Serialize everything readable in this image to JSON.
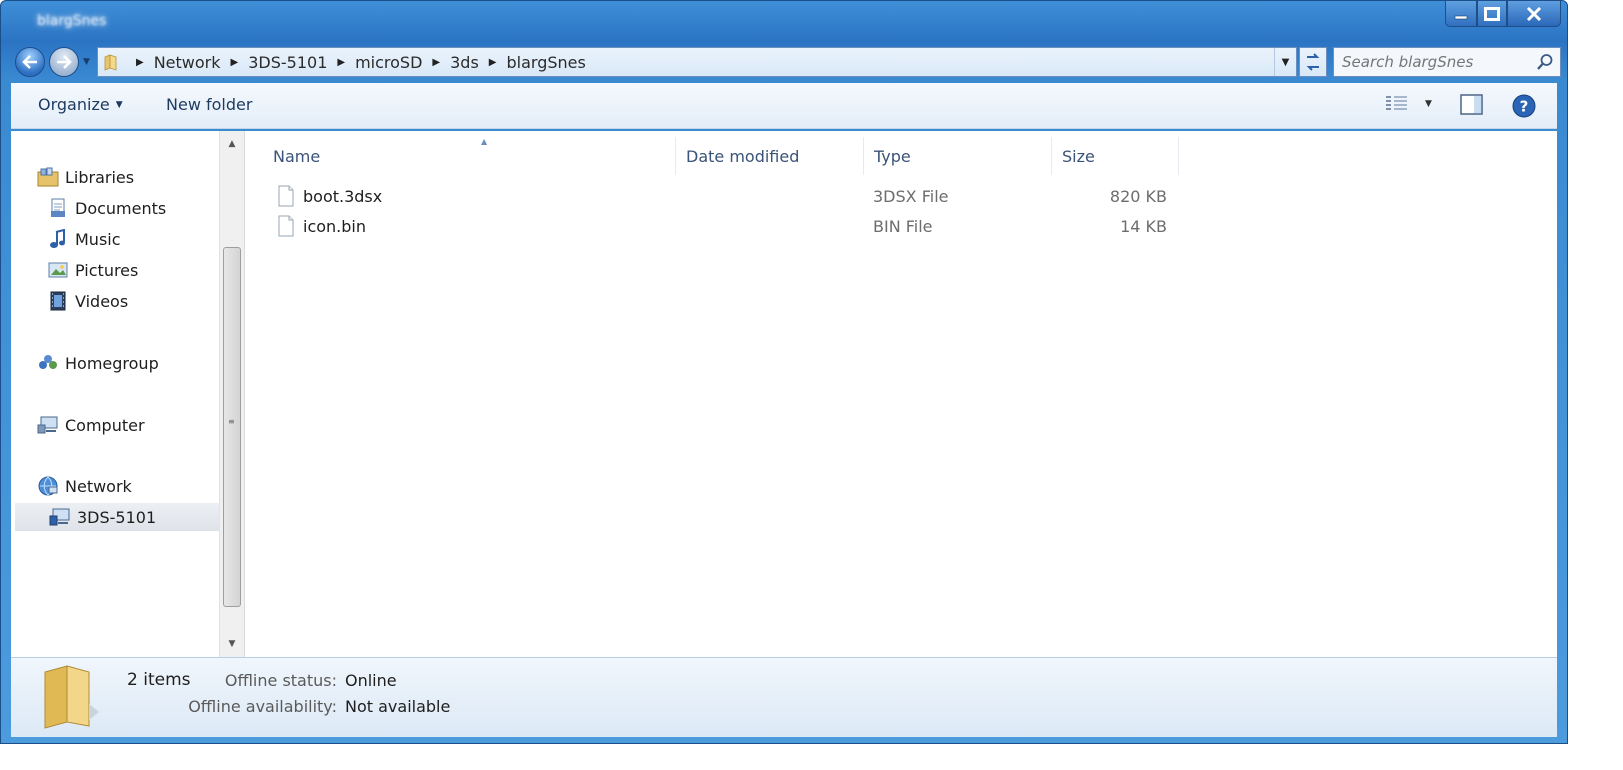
{
  "window": {
    "title": "blargSnes"
  },
  "nav": {
    "breadcrumbs": [
      "Network",
      "3DS-5101",
      "microSD",
      "3ds",
      "blargSnes"
    ],
    "search_placeholder": "Search blargSnes"
  },
  "toolbar": {
    "organize_label": "Organize",
    "new_folder_label": "New folder"
  },
  "sidebar": {
    "items": [
      {
        "label": "Libraries",
        "icon": "libraries-icon"
      },
      {
        "label": "Documents",
        "icon": "documents-icon"
      },
      {
        "label": "Music",
        "icon": "music-icon"
      },
      {
        "label": "Pictures",
        "icon": "pictures-icon"
      },
      {
        "label": "Videos",
        "icon": "videos-icon"
      },
      {
        "label": "Homegroup",
        "icon": "homegroup-icon"
      },
      {
        "label": "Computer",
        "icon": "computer-icon"
      },
      {
        "label": "Network",
        "icon": "network-icon"
      },
      {
        "label": "3DS-5101",
        "icon": "network-computer-icon",
        "selected": true
      }
    ]
  },
  "file_list": {
    "columns": [
      "Name",
      "Date modified",
      "Type",
      "Size"
    ],
    "rows": [
      {
        "name": "boot.3dsx",
        "date_modified": "",
        "type": "3DSX File",
        "size": "820 KB"
      },
      {
        "name": "icon.bin",
        "date_modified": "",
        "type": "BIN File",
        "size": "14 KB"
      }
    ]
  },
  "details": {
    "item_count": "2 items",
    "offline_status_label": "Offline status:",
    "offline_status_value": "Online",
    "offline_availability_label": "Offline availability:",
    "offline_availability_value": "Not available"
  },
  "colors": {
    "frame": "#2b74c4",
    "column_header_text": "#3a5378",
    "secondary_text": "#6d6d6d"
  }
}
